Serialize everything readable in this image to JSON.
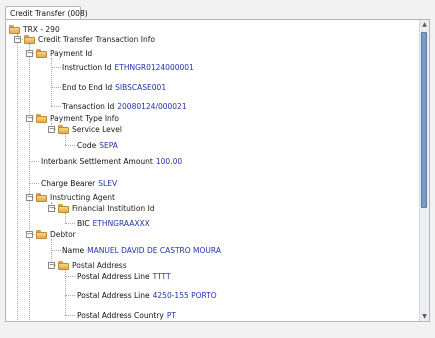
{
  "tab": {
    "label": "Credit Transfer (008)"
  },
  "tree": {
    "root": "TRX - 290",
    "cti": "Credit Transfer Transaction Info",
    "payment_id": {
      "label": "Payment Id",
      "instruction_id": {
        "label": "Instruction Id",
        "value": "ETHNGR0124000001"
      },
      "end_to_end_id": {
        "label": "End to End Id",
        "value": "SIBSCASE001"
      },
      "transaction_id": {
        "label": "Transaction Id",
        "value": "20080124/000021"
      }
    },
    "payment_type_info": {
      "label": "Payment Type Info",
      "service_level": {
        "label": "Service Level",
        "code": {
          "label": "Code",
          "value": "SEPA"
        }
      }
    },
    "settlement_amount": {
      "label": "Interbank Settlement Amount",
      "value": "100.00"
    },
    "charge_bearer": {
      "label": "Charge Bearer",
      "value": "SLEV"
    },
    "instructing_agent": {
      "label": "Instructing Agent",
      "fin_inst": {
        "label": "Financial Institution Id",
        "bic": {
          "label": "BIC",
          "value": "ETHNGRAAXXX"
        }
      }
    },
    "debtor": {
      "label": "Debtor",
      "name": {
        "label": "Name",
        "value": "MANUEL DAVID DE CASTRO MOURA"
      },
      "postal_address": {
        "label": "Postal Address",
        "line1": {
          "label": "Postal Address Line",
          "value": "TTTT"
        },
        "line2": {
          "label": "Postal Address Line",
          "value": "4250-155 PORTO"
        },
        "country": {
          "label": "Postal Address Country",
          "value": "PT"
        }
      }
    }
  }
}
